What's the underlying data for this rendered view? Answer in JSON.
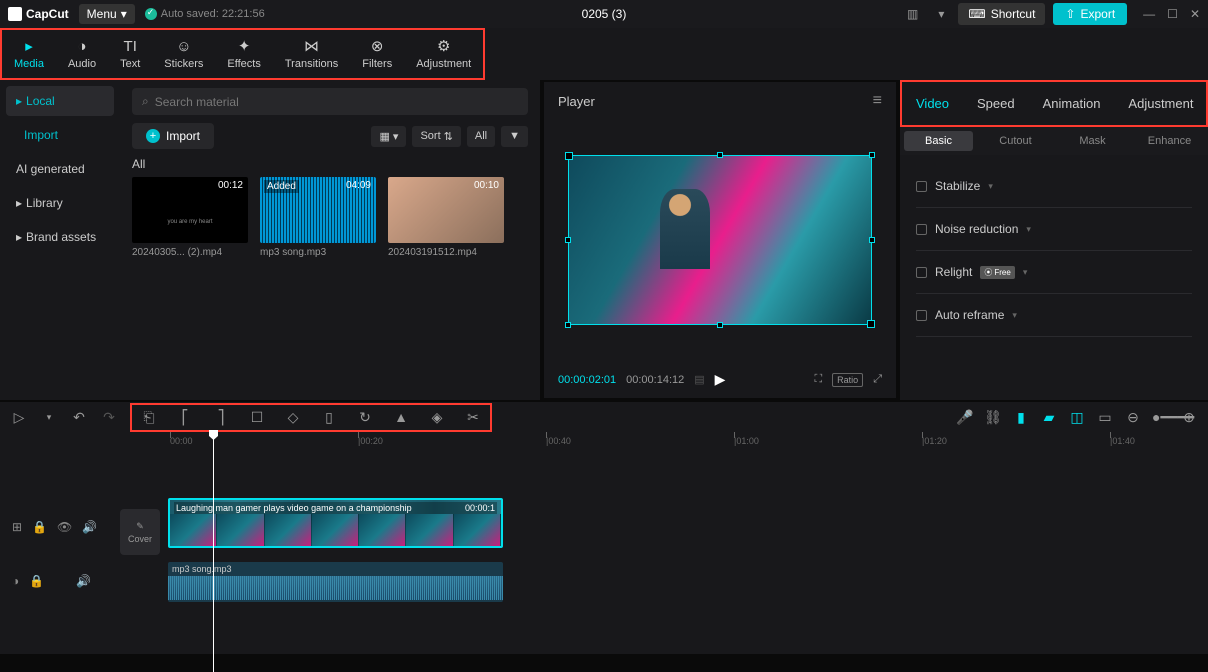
{
  "app": {
    "name": "CapCut",
    "menu": "Menu",
    "autosave": "Auto saved: 22:21:56",
    "project": "0205 (3)"
  },
  "topright": {
    "shortcut": "Shortcut",
    "export": "Export"
  },
  "mediaTabs": [
    "Media",
    "Audio",
    "Text",
    "Stickers",
    "Effects",
    "Transitions",
    "Filters",
    "Adjustment"
  ],
  "sidebar": {
    "local": "Local",
    "import": "Import",
    "ai": "AI generated",
    "library": "Library",
    "brand": "Brand assets"
  },
  "media": {
    "searchPlaceholder": "Search material",
    "importBtn": "Import",
    "sort": "Sort",
    "all": "All",
    "section": "All",
    "items": [
      {
        "dur": "00:12",
        "name": "20240305... (2).mp4",
        "caption": "you are my heart"
      },
      {
        "dur": "04:09",
        "name": "mp3 song.mp3",
        "added": "Added"
      },
      {
        "dur": "00:10",
        "name": "20240319151​2.mp4"
      }
    ]
  },
  "player": {
    "title": "Player",
    "cur": "00:00:02:01",
    "total": "00:00:14:12",
    "ratio": "Ratio"
  },
  "propTabs": [
    "Video",
    "Speed",
    "Animation",
    "Adjustment"
  ],
  "subTabs": [
    "Basic",
    "Cutout",
    "Mask",
    "Enhance"
  ],
  "props": {
    "stabilize": "Stabilize",
    "noise": "Noise reduction",
    "relight": "Relight",
    "free": "Free",
    "reframe": "Auto reframe"
  },
  "ruler": [
    "00:00",
    "|00:20",
    "|00:40",
    "|01:00",
    "|01:20",
    "|01:40"
  ],
  "clip": {
    "name": "Laughing man gamer plays video game on a championship",
    "dur": "00:00:1"
  },
  "audioClip": {
    "name": "mp3 song.mp3"
  },
  "cover": "Cover"
}
